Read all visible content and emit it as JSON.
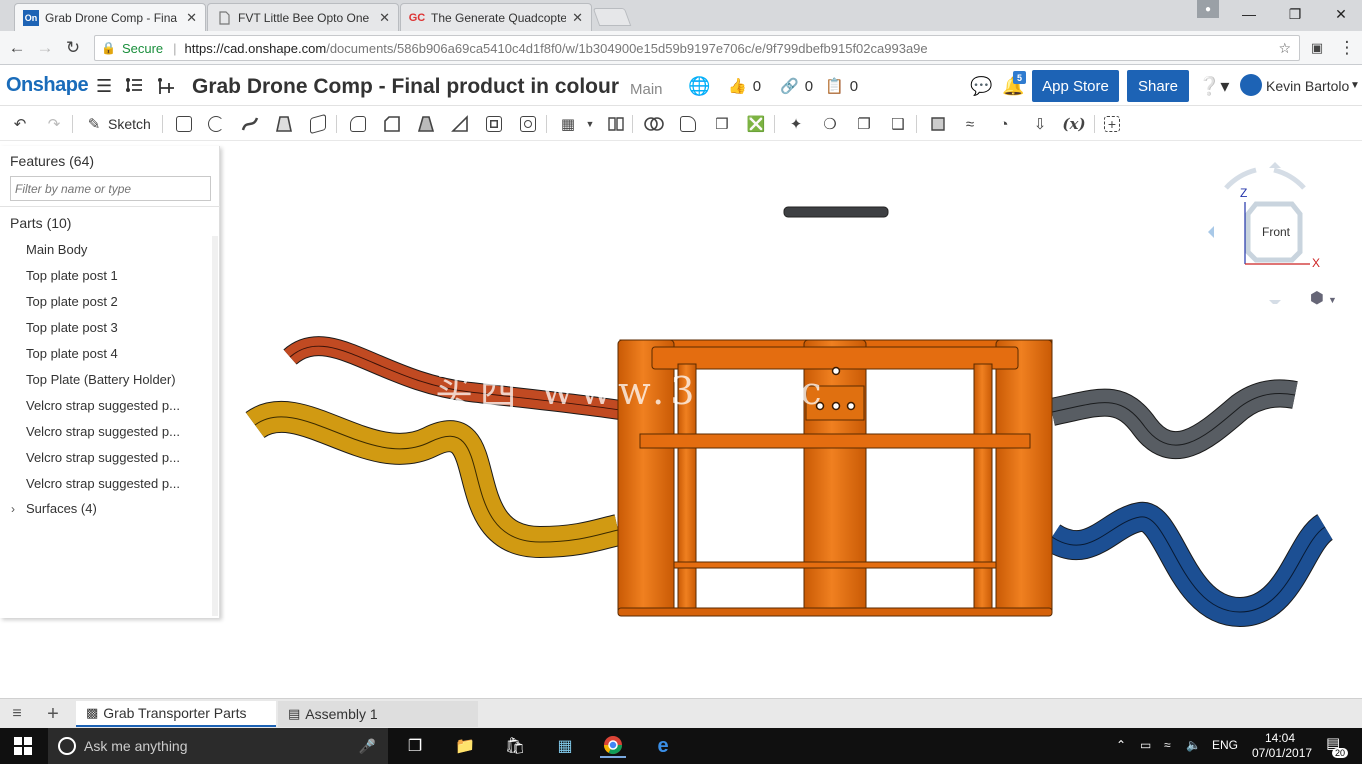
{
  "browser": {
    "tabs": [
      {
        "favicon": "On",
        "title": "Grab Drone Comp - Fina",
        "active": true
      },
      {
        "favicon": "doc-icon",
        "title": "FVT Little Bee Opto One",
        "active": false
      },
      {
        "favicon": "GC",
        "title": "The Generate Quadcopte",
        "active": false
      }
    ],
    "secure_label": "Secure",
    "url_host": "https://cad.onshape.com",
    "url_path": "/documents/586b906a69ca5410c4d1f8f0/w/1b304900e15d59b9197e706c/e/9f799dbefb915f02ca993a9e"
  },
  "header": {
    "logo": "Onshape",
    "document_title": "Grab Drone Comp - Final product in colour",
    "branch": "Main",
    "likes": "0",
    "links": "0",
    "copies": "0",
    "notifications": "5",
    "app_store_label": "App Store",
    "share_label": "Share",
    "user_name": "Kevin Bartolo"
  },
  "toolbar": {
    "sketch_label": "Sketch",
    "variable_label": "(x)"
  },
  "feature_panel": {
    "features_heading": "Features (64)",
    "filter_placeholder": "Filter by name or type",
    "parts_heading": "Parts (10)",
    "parts": [
      "Main Body",
      "Top plate post 1",
      "Top plate post 2",
      "Top plate post 3",
      "Top plate post 4",
      "Top Plate (Battery Holder)",
      "Velcro strap suggested p...",
      "Velcro strap suggested p...",
      "Velcro strap suggested p...",
      "Velcro strap suggested p..."
    ],
    "surfaces_label": "Surfaces (4)"
  },
  "viewcube": {
    "face_label": "Front",
    "axis_z": "Z",
    "axis_x": "X"
  },
  "colors": {
    "accent": "#1d63b5",
    "body_orange": "#e8700f",
    "strap_red": "#c14a22",
    "strap_yellow": "#d19a12",
    "strap_grey": "#585d63",
    "strap_blue": "#1c4f93"
  },
  "watermark": "买西 www.3 l x.c",
  "bottom_tabs": [
    {
      "label": "Grab Transporter Parts",
      "active": true
    },
    {
      "label": "Assembly 1",
      "active": false
    }
  ],
  "taskbar": {
    "search_placeholder": "Ask me anything",
    "language": "ENG",
    "time": "14:04",
    "date": "07/01/2017",
    "notification_count": "20"
  }
}
